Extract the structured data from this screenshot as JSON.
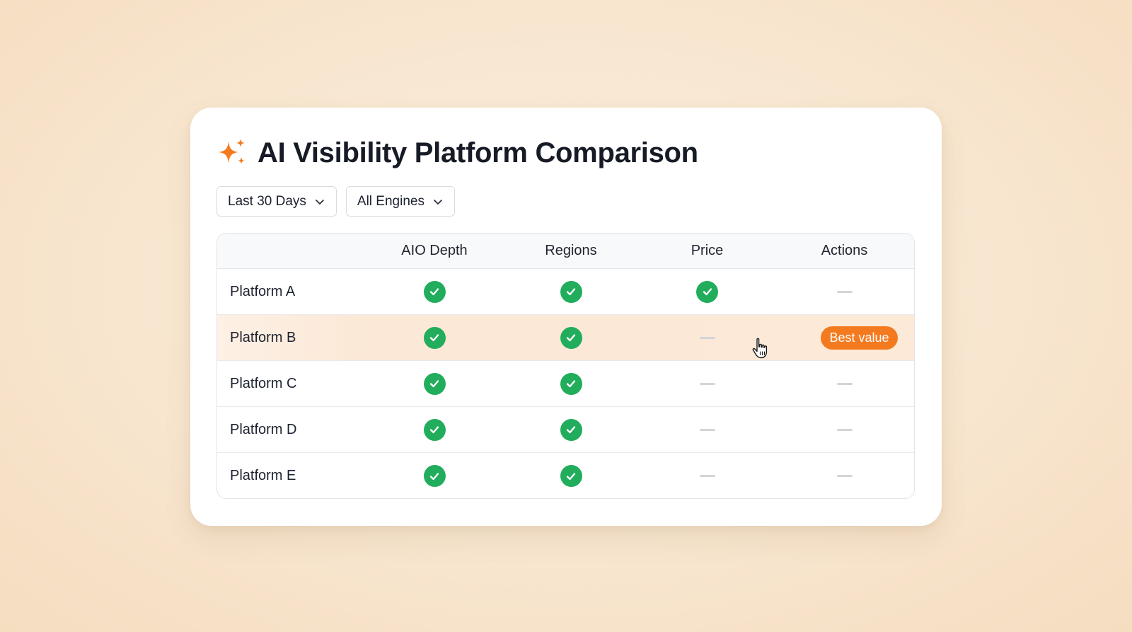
{
  "page": {
    "title": "AI Visibility Platform Comparison",
    "title_icon": "sparkle-icon",
    "accent_color": "#f47a1f"
  },
  "filters": {
    "date_range": "Last 30 Days",
    "engine": "All Engines"
  },
  "table": {
    "columns": [
      "",
      "AIO Depth",
      "Regions",
      "Price",
      "Actions"
    ],
    "rows": [
      {
        "name": "Platform A",
        "aio_depth": true,
        "regions": true,
        "price": true,
        "action": null
      },
      {
        "name": "Platform B",
        "aio_depth": true,
        "regions": true,
        "price": false,
        "action": "Best value",
        "highlighted": true
      },
      {
        "name": "Platform C",
        "aio_depth": true,
        "regions": true,
        "price": false,
        "action": null
      },
      {
        "name": "Platform D",
        "aio_depth": true,
        "regions": true,
        "price": false,
        "action": null
      },
      {
        "name": "Platform E",
        "aio_depth": true,
        "regions": true,
        "price": false,
        "action": null
      }
    ],
    "check_color": "#22ad5c"
  }
}
